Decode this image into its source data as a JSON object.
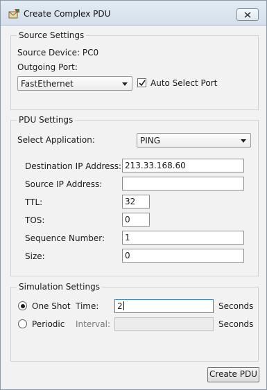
{
  "window": {
    "title": "Create Complex PDU",
    "icon": "pdu-envelope-icon",
    "close_icon": "close-icon"
  },
  "source_settings": {
    "legend": "Source Settings",
    "source_device": "Source Device: PC0",
    "outgoing_port_label": "Outgoing Port:",
    "port_value": "FastEthernet",
    "auto_select_label": "Auto Select Port",
    "auto_select_checked": true
  },
  "pdu_settings": {
    "legend": "PDU Settings",
    "select_app_label": "Select Application:",
    "application": "PING",
    "dest_ip_label": "Destination IP Address:",
    "dest_ip": "213.33.168.60",
    "src_ip_label": "Source IP Address:",
    "src_ip": "",
    "ttl_label": "TTL:",
    "ttl": "32",
    "tos_label": "TOS:",
    "tos": "0",
    "seq_label": "Sequence Number:",
    "seq": "1",
    "size_label": "Size:",
    "size": "0"
  },
  "simulation_settings": {
    "legend": "Simulation Settings",
    "one_shot_label": "One Shot",
    "one_shot_selected": true,
    "time_label": "Time:",
    "time_value": "2",
    "seconds_label": "Seconds",
    "periodic_label": "Periodic",
    "interval_label": "Interval:",
    "interval_value": "",
    "seconds_label_2": "Seconds"
  },
  "actions": {
    "create_label": "Create PDU"
  },
  "colors": {
    "focus_border": "#3a84c4",
    "window_bg": "#f2f2f2"
  }
}
